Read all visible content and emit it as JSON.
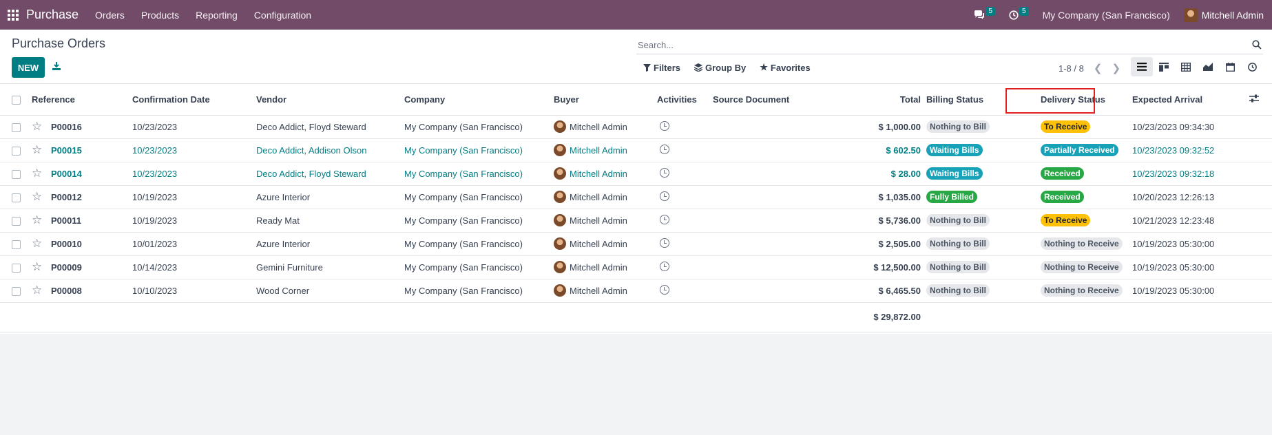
{
  "navbar": {
    "app_name": "Purchase",
    "menus": [
      "Orders",
      "Products",
      "Reporting",
      "Configuration"
    ],
    "messages_count": "5",
    "activities_count": "5",
    "company": "My Company (San Francisco)",
    "user": "Mitchell Admin"
  },
  "control": {
    "title": "Purchase Orders",
    "new_label": "NEW",
    "search_placeholder": "Search...",
    "filters_label": "Filters",
    "group_by_label": "Group By",
    "favorites_label": "Favorites",
    "pager": "1-8 / 8"
  },
  "table": {
    "headers": [
      "Reference",
      "Confirmation Date",
      "Vendor",
      "Company",
      "Buyer",
      "Activities",
      "Source Document",
      "Total",
      "Billing Status",
      "Delivery Status",
      "Expected Arrival"
    ],
    "rows": [
      {
        "ref": "P00016",
        "date": "10/23/2023",
        "vendor": "Deco Addict, Floyd Steward",
        "company": "My Company (San Francisco)",
        "buyer": "Mitchell Admin",
        "total": "$ 1,000.00",
        "billing": "Nothing to Bill",
        "billing_color": "grey",
        "delivery": "To Receive",
        "delivery_color": "yellow",
        "arrival": "10/23/2023 09:34:30",
        "link": false
      },
      {
        "ref": "P00015",
        "date": "10/23/2023",
        "vendor": "Deco Addict, Addison Olson",
        "company": "My Company (San Francisco)",
        "buyer": "Mitchell Admin",
        "total": "$ 602.50",
        "billing": "Waiting Bills",
        "billing_color": "blue",
        "delivery": "Partially Received",
        "delivery_color": "blue",
        "arrival": "10/23/2023 09:32:52",
        "link": true
      },
      {
        "ref": "P00014",
        "date": "10/23/2023",
        "vendor": "Deco Addict, Floyd Steward",
        "company": "My Company (San Francisco)",
        "buyer": "Mitchell Admin",
        "total": "$ 28.00",
        "billing": "Waiting Bills",
        "billing_color": "blue",
        "delivery": "Received",
        "delivery_color": "green",
        "arrival": "10/23/2023 09:32:18",
        "link": true
      },
      {
        "ref": "P00012",
        "date": "10/19/2023",
        "vendor": "Azure Interior",
        "company": "My Company (San Francisco)",
        "buyer": "Mitchell Admin",
        "total": "$ 1,035.00",
        "billing": "Fully Billed",
        "billing_color": "green",
        "delivery": "Received",
        "delivery_color": "green",
        "arrival": "10/20/2023 12:26:13",
        "link": false
      },
      {
        "ref": "P00011",
        "date": "10/19/2023",
        "vendor": "Ready Mat",
        "company": "My Company (San Francisco)",
        "buyer": "Mitchell Admin",
        "total": "$ 5,736.00",
        "billing": "Nothing to Bill",
        "billing_color": "grey",
        "delivery": "To Receive",
        "delivery_color": "yellow",
        "arrival": "10/21/2023 12:23:48",
        "link": false
      },
      {
        "ref": "P00010",
        "date": "10/01/2023",
        "vendor": "Azure Interior",
        "company": "My Company (San Francisco)",
        "buyer": "Mitchell Admin",
        "total": "$ 2,505.00",
        "billing": "Nothing to Bill",
        "billing_color": "grey",
        "delivery": "Nothing to Receive",
        "delivery_color": "grey",
        "arrival": "10/19/2023 05:30:00",
        "link": false
      },
      {
        "ref": "P00009",
        "date": "10/14/2023",
        "vendor": "Gemini Furniture",
        "company": "My Company (San Francisco)",
        "buyer": "Mitchell Admin",
        "total": "$ 12,500.00",
        "billing": "Nothing to Bill",
        "billing_color": "grey",
        "delivery": "Nothing to Receive",
        "delivery_color": "grey",
        "arrival": "10/19/2023 05:30:00",
        "link": false
      },
      {
        "ref": "P00008",
        "date": "10/10/2023",
        "vendor": "Wood Corner",
        "company": "My Company (San Francisco)",
        "buyer": "Mitchell Admin",
        "total": "$ 6,465.50",
        "billing": "Nothing to Bill",
        "billing_color": "grey",
        "delivery": "Nothing to Receive",
        "delivery_color": "grey",
        "arrival": "10/19/2023 05:30:00",
        "link": false
      }
    ],
    "grand_total": "$ 29,872.00"
  },
  "colors": {
    "brand": "#714b67",
    "accent": "#017e84",
    "highlight_box": "#e02020"
  }
}
